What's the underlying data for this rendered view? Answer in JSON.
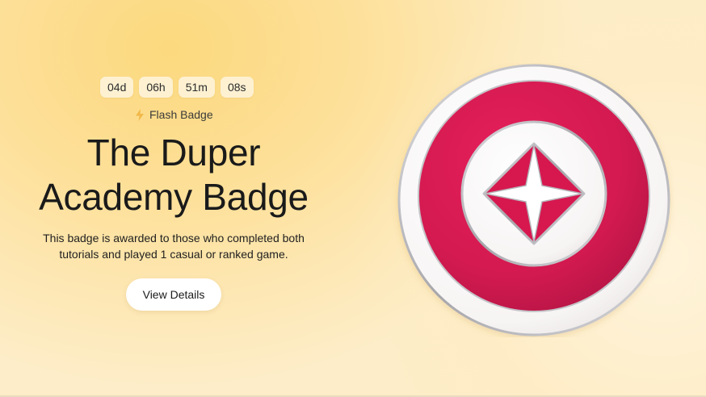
{
  "countdown": {
    "days": "04d",
    "hours": "06h",
    "minutes": "51m",
    "seconds": "08s"
  },
  "flash": {
    "icon": "lightning-icon",
    "label": "Flash Badge"
  },
  "hero": {
    "title_line1": "The Duper",
    "title_line2": "Academy Badge",
    "description_line1": "This badge is awarded to those who completed both",
    "description_line2": "tutorials and played 1 casual or ranked game.",
    "button_label": "View Details"
  },
  "badge": {
    "icon": "star-diamond-badge-icon",
    "colors": {
      "outer_ring": "#fbfafa",
      "red_ring": "#d41a52",
      "inner_disc": "#fdfcfc",
      "diamond": "#d6184f",
      "star": "#ffffff",
      "metal": "#b9b9bd"
    }
  },
  "colors": {
    "background": "#fde09a",
    "countdown_box": "#fdf1d2",
    "button": "#ffffff"
  }
}
